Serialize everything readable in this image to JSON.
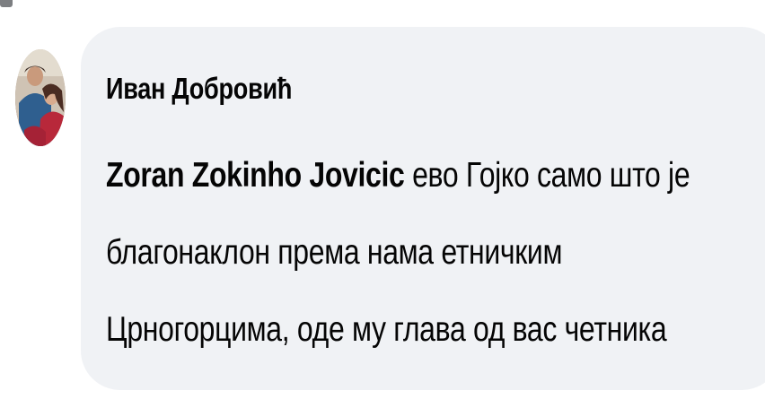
{
  "comment": {
    "author": "Иван Добровић",
    "mention": "Zoran Zokinho Jovicic",
    "lines": [
      " ево Гојко само што је",
      "благонаклон према нама етничким",
      "Црногорцима, оде му глава од вас четника"
    ]
  },
  "colors": {
    "bubble": "#f0f2f5",
    "text": "#050505",
    "page": "#ffffff"
  },
  "icons": {
    "avatar": "profile-photo"
  }
}
